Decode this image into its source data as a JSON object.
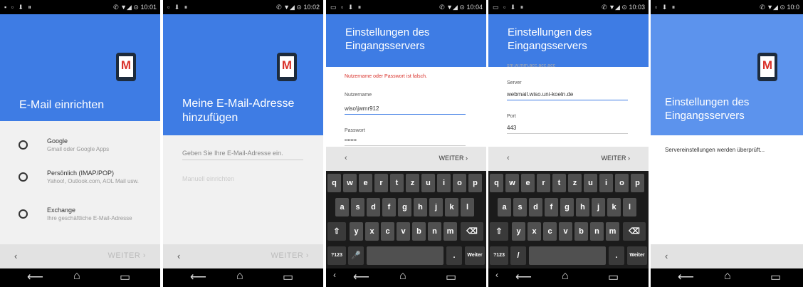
{
  "status_bars": [
    {
      "left": "▪ ▫ ⬇ ⏸",
      "right": "✆ ▼◢ ⊙ 10:01"
    },
    {
      "left": "▫ ⬇ ⏸",
      "right": "✆ ▼◢ ⊙ 10:02"
    },
    {
      "left": "▭ ▫ ⬇ ⏸",
      "right": "✆ ▼◢ ⊙ 10:04"
    },
    {
      "left": "▭ ▫ ⬇ ⏸",
      "right": "✆ ▼◢ ⊙ 10:03"
    },
    {
      "left": "▫ ⬇ ⏸",
      "right": "✆ ▼◢ ⊙ 10:0"
    }
  ],
  "screen1": {
    "title": "E-Mail einrichten",
    "options": [
      {
        "title": "Google",
        "subtitle": "Gmail oder Google Apps"
      },
      {
        "title": "Persönlich (IMAP/POP)",
        "subtitle": "Yahoo!, Outlook.com, AOL Mail usw."
      },
      {
        "title": "Exchange",
        "subtitle": "Ihre geschäftliche E-Mail-Adresse"
      }
    ],
    "back": "‹",
    "next": "WEITER ›"
  },
  "screen2": {
    "title": "Meine E-Mail-Adresse hinzufügen",
    "placeholder": "Geben Sie Ihre E-Mail-Adresse ein.",
    "manual": "Manuell einrichten",
    "back": "‹",
    "next": "WEITER ›"
  },
  "screen3": {
    "title": "Einstellungen des Eingangsservers",
    "error": "Nutzername oder Passwort ist falsch.",
    "username_label": "Nutzername",
    "username_value": "wiso\\jwmr912",
    "password_label": "Passwort",
    "password_value": "••••••••",
    "back": "‹",
    "next": "WEITER ›",
    "keyboard_bottom": {
      "num": "?123",
      "mic": "🎤",
      "dot": ".",
      "enter": "Weiter"
    }
  },
  "screen4": {
    "title": "Einstellungen des Eingangsservers",
    "cutoff": "sm.w.mm.acc.acc.acc",
    "server_label": "Server",
    "server_value": "webmail.wiso.uni-koeln.de",
    "port_label": "Port",
    "port_value": "443",
    "back": "‹",
    "next": "WEITER ›",
    "keyboard_bottom": {
      "num": "?123",
      "slash": "/",
      "dot": ".",
      "enter": "Weiter"
    }
  },
  "screen5": {
    "title": "Einstellungen des Eingangsservers",
    "checking": "Servereinstellungen werden überprüft...",
    "back": "‹"
  },
  "keyboard": {
    "row1": [
      "q",
      "w",
      "e",
      "r",
      "t",
      "z",
      "u",
      "i",
      "o",
      "p"
    ],
    "row2": [
      "a",
      "s",
      "d",
      "f",
      "g",
      "h",
      "j",
      "k",
      "l"
    ],
    "row3": [
      "y",
      "x",
      "c",
      "v",
      "b",
      "n",
      "m"
    ],
    "shift": "⇧",
    "backspace": "⌫"
  },
  "nav": {
    "back": "⟵",
    "home": "⌂",
    "recent": "▭"
  },
  "colors": {
    "header": "#3e7ce4",
    "accent": "#3e7ce4",
    "error": "#d9322b"
  }
}
